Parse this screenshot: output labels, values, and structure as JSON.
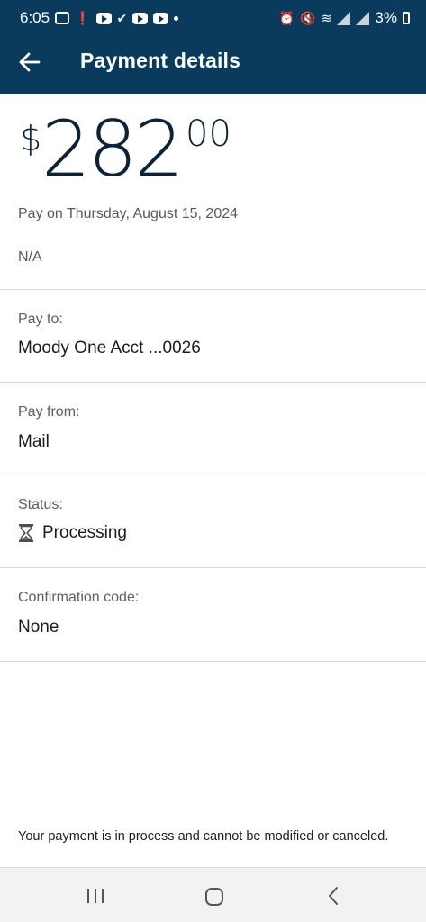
{
  "status_bar": {
    "time": "6:05",
    "battery": "3%"
  },
  "app_bar": {
    "title": "Payment details",
    "back_icon": "arrow-left-icon"
  },
  "payment": {
    "currency_symbol": "$",
    "amount_whole": "282",
    "amount_cents": "00",
    "pay_date": "Pay on Thursday, August 15, 2024",
    "memo": "N/A"
  },
  "fields": {
    "pay_to_label": "Pay to:",
    "pay_to_value": "Moody One Acct  ...0026",
    "pay_from_label": "Pay from:",
    "pay_from_value": "Mail",
    "status_label": "Status:",
    "status_value": "Processing",
    "status_icon": "hourglass-icon",
    "confirmation_label": "Confirmation code:",
    "confirmation_value": "None"
  },
  "footer": {
    "note": "Your payment is in process and cannot be modified or canceled."
  },
  "colors": {
    "header_bg": "#0b3b5c",
    "amount_text": "#0c2236",
    "divider": "#d4d6d9"
  }
}
